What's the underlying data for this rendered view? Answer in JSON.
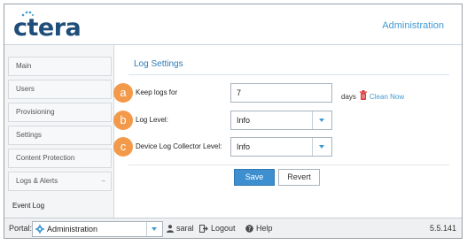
{
  "header": {
    "logo_text": "ctera",
    "title": "Administration"
  },
  "sidebar": {
    "items": [
      {
        "label": "Main"
      },
      {
        "label": "Users"
      },
      {
        "label": "Provisioning"
      },
      {
        "label": "Settings"
      },
      {
        "label": "Content Protection"
      },
      {
        "label": "Logs & Alerts",
        "collapse": "−"
      }
    ],
    "subitems": [
      {
        "label": "Event Log"
      }
    ]
  },
  "main": {
    "title": "Log Settings",
    "rows": [
      {
        "badge": "a",
        "label": "Keep logs for",
        "value": "7",
        "unit": "days",
        "action": "Clean Now"
      },
      {
        "badge": "b",
        "label": "Log Level:",
        "value": "Info"
      },
      {
        "badge": "c",
        "label": "Device Log Collector Level:",
        "value": "Info"
      }
    ],
    "save_label": "Save",
    "revert_label": "Revert"
  },
  "footer": {
    "portal_label": "Portal:",
    "portal_value": "Administration",
    "user": "saral",
    "logout": "Logout",
    "help": "Help",
    "version": "5.5.141"
  },
  "colors": {
    "accent": "#3f9ad3",
    "logo": "#1e4e79",
    "badge": "#f39a4a",
    "save": "#3d8fd0"
  },
  "icons": [
    "gear-icon",
    "user-icon",
    "logout-icon",
    "help-icon",
    "trash-icon",
    "chevron-down-icon"
  ]
}
